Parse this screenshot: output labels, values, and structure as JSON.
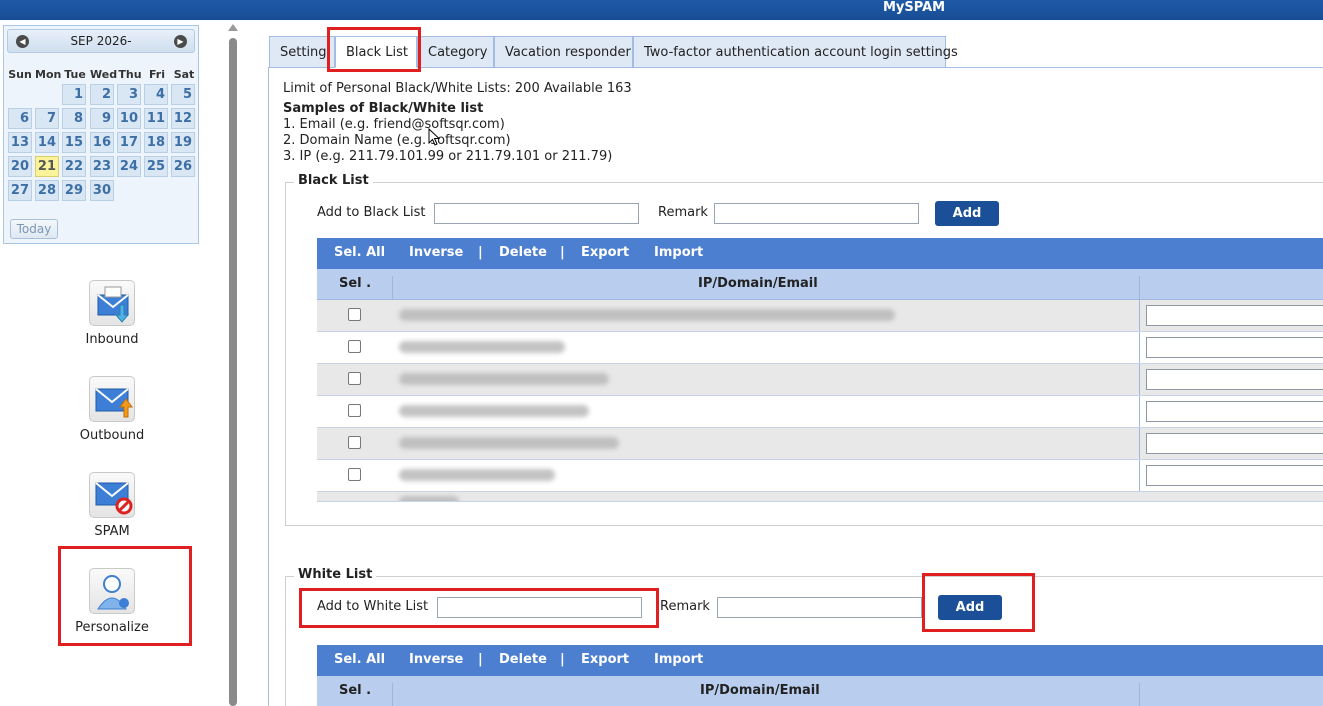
{
  "app_title": "MySPAM",
  "calendar": {
    "month_label": "SEP 2026-",
    "weekdays": [
      "Sun",
      "Mon",
      "Tue",
      "Wed",
      "Thu",
      "Fri",
      "Sat"
    ],
    "days": [
      "1",
      "2",
      "3",
      "4",
      "5",
      "6",
      "7",
      "8",
      "9",
      "10",
      "11",
      "12",
      "13",
      "14",
      "15",
      "16",
      "17",
      "18",
      "19",
      "20",
      "21",
      "22",
      "23",
      "24",
      "25",
      "26",
      "27",
      "28",
      "29",
      "30"
    ],
    "highlighted_day": "21",
    "today_label": "Today"
  },
  "nav": {
    "items": [
      {
        "label": "Inbound",
        "icon": "inbound-mail-icon"
      },
      {
        "label": "Outbound",
        "icon": "outbound-mail-icon"
      },
      {
        "label": "SPAM",
        "icon": "spam-mail-icon"
      },
      {
        "label": "Personalize",
        "icon": "personalize-user-icon"
      }
    ]
  },
  "tabs": [
    {
      "label": "Setting"
    },
    {
      "label": "Black List"
    },
    {
      "label": "Category"
    },
    {
      "label": "Vacation responder"
    },
    {
      "label": "Two-factor authentication account login settings"
    }
  ],
  "info": {
    "limit_text": "Limit of Personal Black/White Lists: 200 Available 163",
    "samples_title": "Samples of Black/White list",
    "samples": [
      "1. Email (e.g. friend@softsqr.com)",
      "2. Domain Name (e.g. softsqr.com)",
      "3. IP (e.g. 211.79.101.99 or 211.79.101 or 211.79)"
    ]
  },
  "black_list": {
    "legend": "Black List",
    "add_label": "Add to Black List",
    "remark_label": "Remark",
    "add_button": "Add",
    "toolbar": {
      "select_all": "Sel. All",
      "inverse": "Inverse",
      "delete": "Delete",
      "export": "Export",
      "import": "Import",
      "separator": "|"
    },
    "columns": {
      "sel": "Sel .",
      "entry": "IP/Domain/Email"
    }
  },
  "white_list": {
    "legend": "White List",
    "add_label": "Add to White List",
    "remark_label": "Remark",
    "add_button": "Add",
    "toolbar": {
      "select_all": "Sel. All",
      "inverse": "Inverse",
      "delete": "Delete",
      "export": "Export",
      "import": "Import",
      "separator": "|"
    },
    "columns": {
      "sel": "Sel .",
      "entry": "IP/Domain/Email"
    }
  },
  "colors": {
    "topbar": "#1f5aa8",
    "toolbar": "#4d7fd0",
    "table_header": "#b9ceef",
    "add_button": "#1b4f97",
    "highlight_box": "#e02020"
  }
}
